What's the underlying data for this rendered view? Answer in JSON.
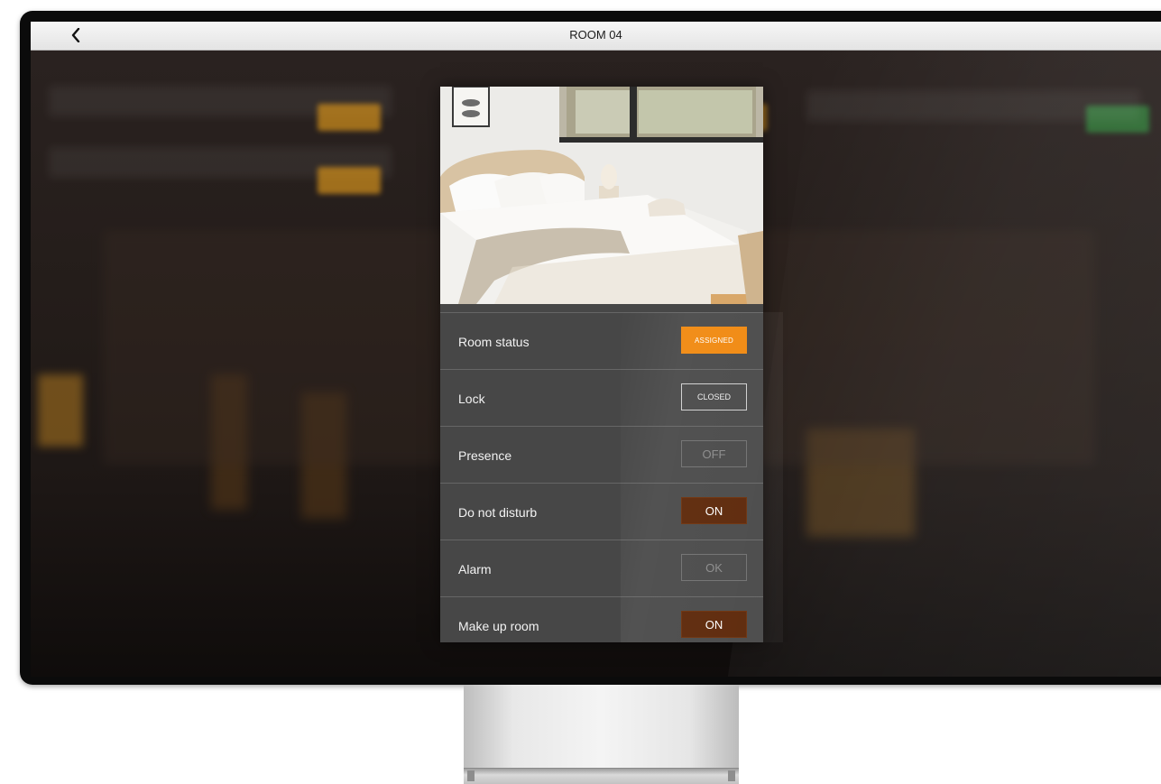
{
  "header": {
    "title": "ROOM 04",
    "back_icon": "chevron-left-icon"
  },
  "room": {
    "photo_icon": "bedroom-photo",
    "rows": [
      {
        "label": "Room status",
        "value": "ASSIGNED",
        "state": "assigned",
        "color": "#f0870c"
      },
      {
        "label": "Lock",
        "value": "CLOSED",
        "state": "closed",
        "color": "#cfcfcf"
      },
      {
        "label": "Presence",
        "value": "OFF",
        "state": "off",
        "color": "#6f6f6f"
      },
      {
        "label": "Do not disturb",
        "value": "ON",
        "state": "on",
        "color": "#5a2405"
      },
      {
        "label": "Alarm",
        "value": "OK",
        "state": "ok",
        "color": "#6f6f6f"
      },
      {
        "label": "Make up room",
        "value": "ON",
        "state": "on",
        "color": "#5a2405"
      }
    ]
  },
  "colors": {
    "accent": "#f0870c",
    "panel": "#474747",
    "active_button": "#5a2405"
  }
}
